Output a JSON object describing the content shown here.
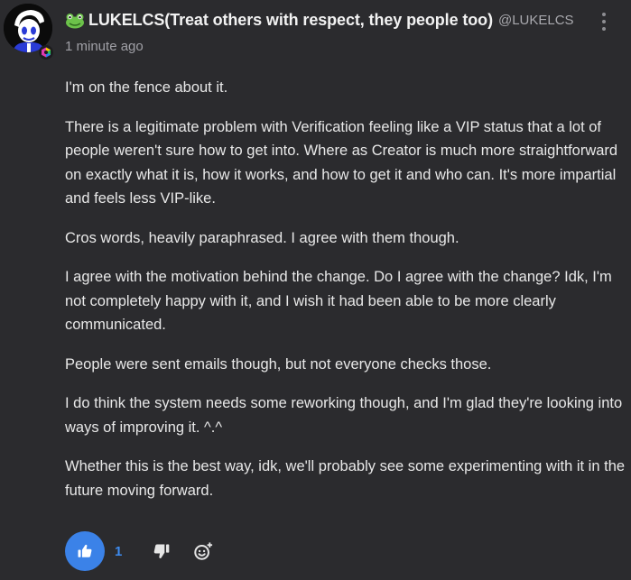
{
  "post": {
    "author_name": "LUKELCS(Treat others with respect, they people too)",
    "author_handle": "@LUKELCS",
    "timestamp": "1 minute ago",
    "paragraphs": [
      "I'm on the fence about it.",
      "There is a legitimate problem with Verification feeling like a VIP status that a lot of people weren't sure how to get into.  Where as Creator is much more straightforward on exactly what it is, how it works, and how to get it and who can.  It's more impartial and feels less VIP-like.",
      "Cros words, heavily paraphrased.  I agree with them though.",
      "I agree with the motivation behind the change.  Do I agree with the change?  Idk, I'm not completely happy with it, and I wish it had been able to be more clearly communicated.",
      "People were sent emails though, but not everyone checks those.",
      "I do think the system needs some reworking though, and I'm glad they're looking into ways of improving it. ^.^",
      "Whether this is the best way, idk, we'll probably see some experimenting with it in the future moving forward."
    ]
  },
  "actions": {
    "like_count": "1",
    "icons": [
      "thumbs-up-icon",
      "thumbs-down-icon",
      "add-reaction-icon",
      "more-options-icon"
    ]
  },
  "colors": {
    "background": "#2b2b2e",
    "accent": "#3b82e8",
    "text": "#e8e8e8",
    "muted": "#a0a0a6"
  }
}
